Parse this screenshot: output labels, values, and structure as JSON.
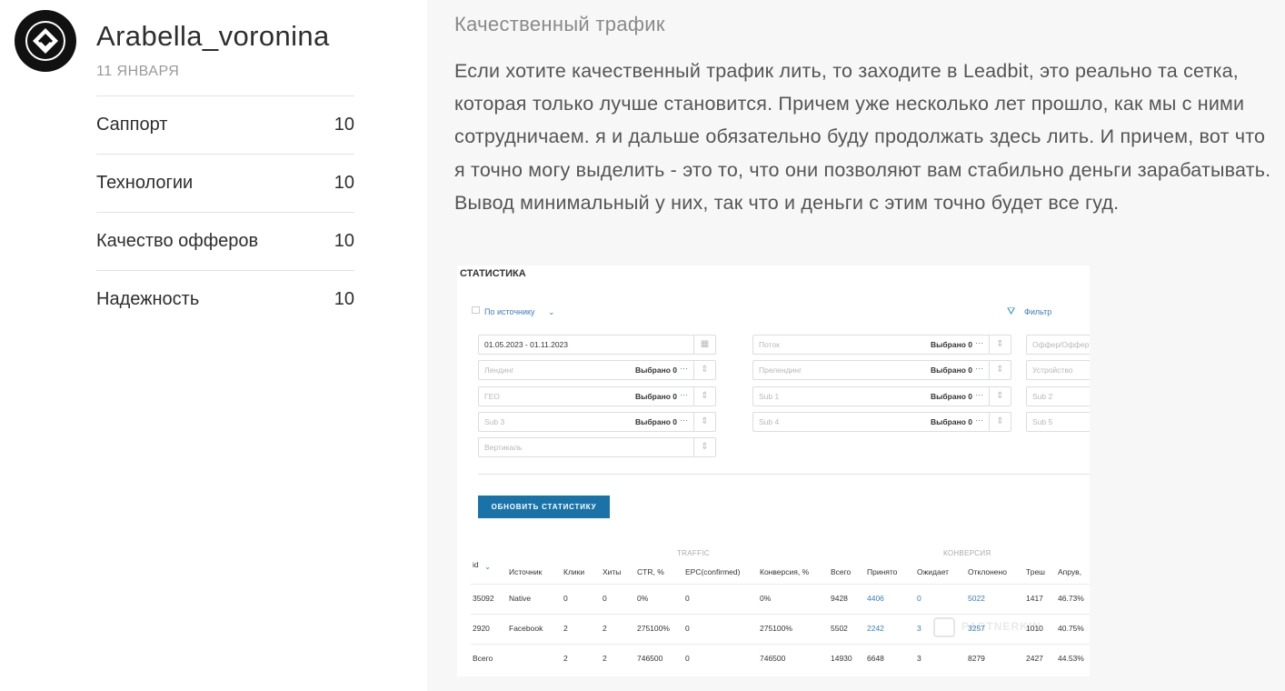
{
  "user": {
    "name": "Arabella_voronina",
    "date": "11 ЯНВАРЯ"
  },
  "ratings": [
    {
      "label": "Саппорт",
      "value": "10"
    },
    {
      "label": "Технологии",
      "value": "10"
    },
    {
      "label": "Качество офферов",
      "value": "10"
    },
    {
      "label": "Надежность",
      "value": "10"
    }
  ],
  "review": {
    "title": "Качественный трафик",
    "body": "Если хотите качественный трафик лить, то заходите в Leadbit, это реально та сетка, которая только лучше становится. Причем уже несколько лет прошло, как мы с ними сотрудничаем. я и дальше обязательно буду продолжать здесь лить. И причем, вот что я точно могу выделить - это то, что они позволяют вам стабильно деньги зарабатывать. Вывод минимальный у них, так что и деньги с этим точно будет все гуд."
  },
  "stats": {
    "title": "СТАТИСТИКА",
    "group_by": "По источнику",
    "filter_label": "Фильтр",
    "date_range": "01.05.2023 - 01.11.2023",
    "selected_label": "Выбрано 0",
    "fields": {
      "stream": "Поток",
      "offer": "Оффер/Оффер",
      "landing": "Лендинг",
      "prelanding": "Прелендинг",
      "device": "Устройство",
      "geo": "ГЕО",
      "sub1": "Sub 1",
      "sub2": "Sub 2",
      "sub3": "Sub 3",
      "sub4": "Sub 4",
      "sub5": "Sub 5",
      "vertical": "Вертикаль"
    },
    "refresh_button": "ОБНОВИТЬ СТАТИСТИКУ",
    "group_traffic": "TRAFFIC",
    "group_conversion": "КОНВЕРСИЯ",
    "columns": [
      "id",
      "Источник",
      "Клики",
      "Хиты",
      "CTR, %",
      "EPC(confirmed)",
      "Конверсия, %",
      "Всего",
      "Принято",
      "Ожидает",
      "Отклонено",
      "Треш",
      "Апрув,"
    ],
    "rows": [
      [
        "35092",
        "Native",
        "0",
        "0",
        "0%",
        "0",
        "0%",
        "9428",
        "4406",
        "0",
        "5022",
        "1417",
        "46.73%"
      ],
      [
        "2920",
        "Facebook",
        "2",
        "2",
        "275100%",
        "0",
        "275100%",
        "5502",
        "2242",
        "3",
        "3257",
        "1010",
        "40.75%"
      ],
      [
        "Всего",
        "",
        "2",
        "2",
        "746500",
        "0",
        "746500",
        "14930",
        "6648",
        "3",
        "8279",
        "2427",
        "44.53%"
      ]
    ],
    "watermark": "PARTNERKIN"
  }
}
